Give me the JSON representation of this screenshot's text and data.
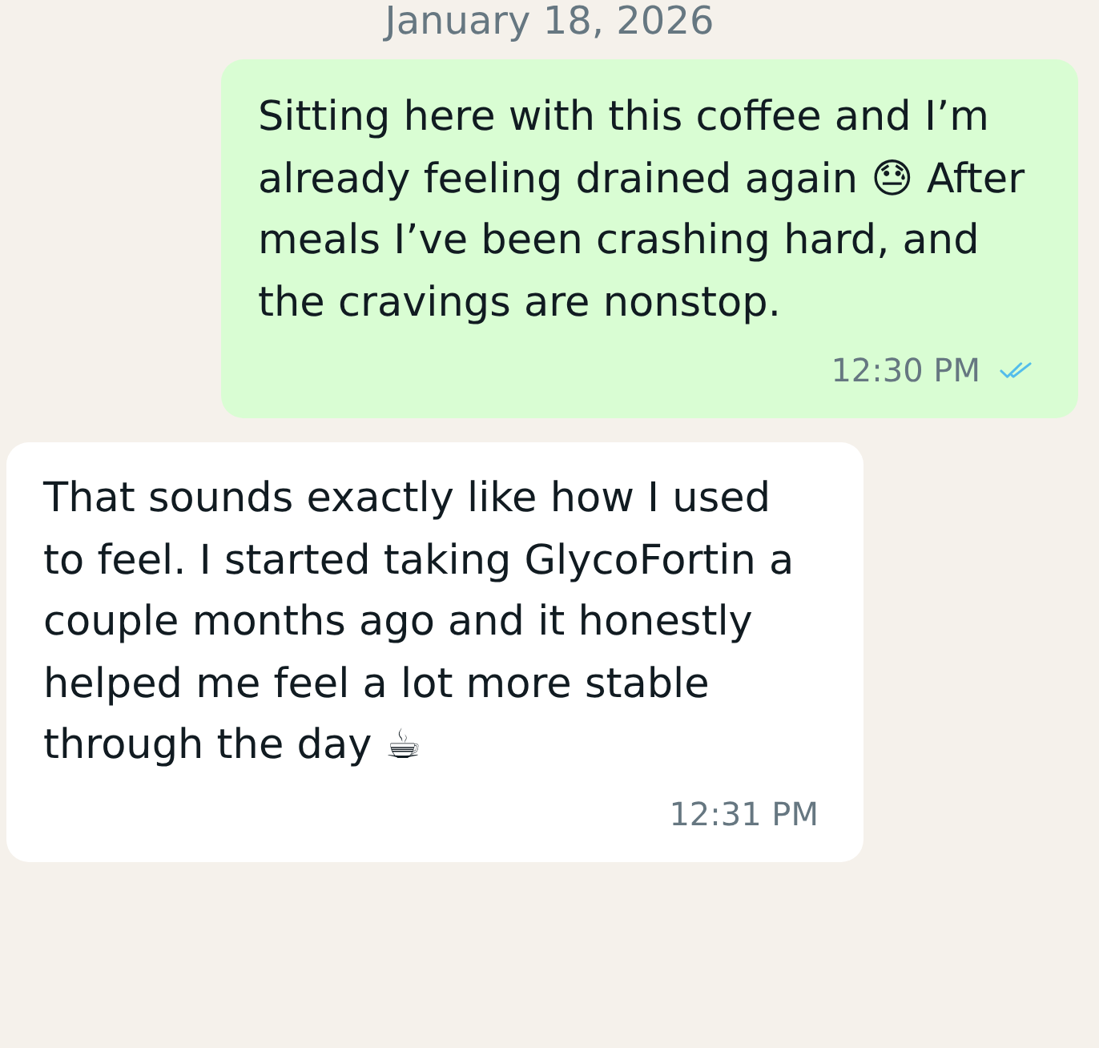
{
  "date_divider": {
    "text": "January 18, 2026"
  },
  "messages": [
    {
      "kind": "outgoing",
      "text": "Sitting here with this coffee and I’m already feeling drained again 😓 After meals I’ve been crashing hard, and the cravings are nonstop.",
      "time": "12:30 PM",
      "read": true
    },
    {
      "kind": "incoming",
      "text": "That sounds exactly like how I used to feel. I started taking GlycoFortin a couple months ago and it honestly helped me feel a lot more stable through the day ☕",
      "time": "12:31 PM"
    }
  ]
}
